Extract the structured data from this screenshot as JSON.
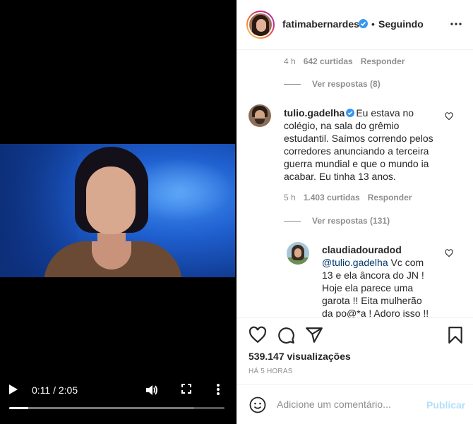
{
  "video": {
    "current_time": "0:11",
    "duration": "2:05",
    "time_display": "0:11 / 2:05",
    "progress_fraction": 0.088,
    "buffer_fraction": 0.86
  },
  "header": {
    "username": "fatimabernardes",
    "separator": "•",
    "follow_status": "Seguindo"
  },
  "comments": {
    "prev_meta": {
      "time": "4 h",
      "likes": "642 curtidas",
      "reply": "Responder"
    },
    "prev_view_replies": "Ver respostas (8)",
    "main": {
      "user": "tulio.gadelha",
      "lines": [
        "Eu estava no",
        "colégio, na sala do grêmio",
        "estudantil. Saímos correndo pelos",
        "corredores anunciando a terceira",
        "guerra mundial e que o mundo ia",
        "acabar. Eu tinha 13 anos."
      ],
      "meta": {
        "time": "5 h",
        "likes": "1.403 curtidas",
        "reply": "Responder"
      },
      "view_replies": "Ver respostas (131)"
    },
    "reply": {
      "user": "claudiadouradod",
      "mention": "@tulio.gadelha",
      "first_line_rest": " Vc com",
      "lines": [
        "13 e ela âncora do JN !",
        "Hoje ela parece uma",
        "garota !! Eita mulherão",
        "da po@*a ! Adoro isso !!"
      ]
    }
  },
  "actions": {
    "views": "539.147 visualizações",
    "time_ago": "HÁ 5 HORAS"
  },
  "comment_box": {
    "placeholder": "Adicione um comentário...",
    "post_label": "Publicar"
  },
  "colors": {
    "verified": "#3897f0",
    "post_disabled": "#b2dffc",
    "mention": "#00376b"
  },
  "icons": [
    "play-icon",
    "volume-icon",
    "fullscreen-icon",
    "more-vertical-icon",
    "verified-icon",
    "more-horizontal-icon",
    "heart-icon",
    "comment-icon",
    "share-icon",
    "bookmark-icon",
    "emoji-icon"
  ]
}
